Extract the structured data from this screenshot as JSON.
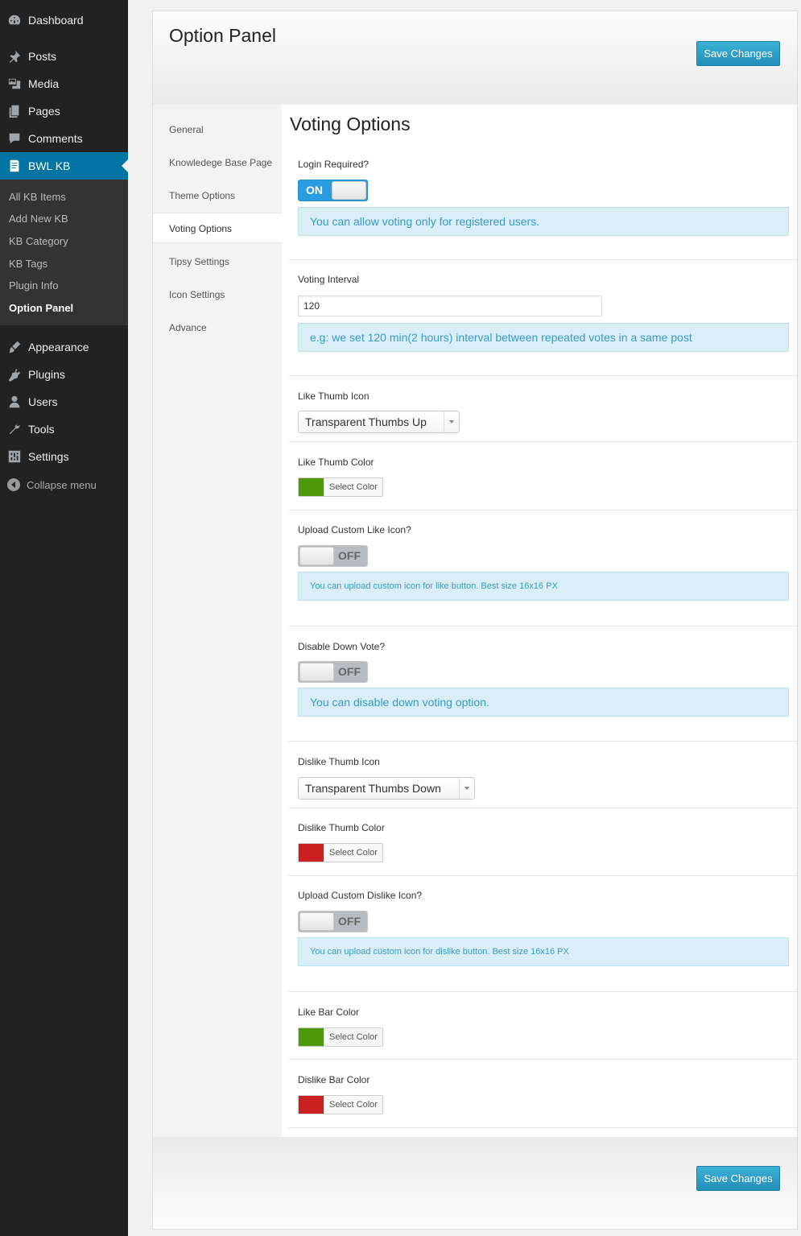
{
  "admin_menu": {
    "items": [
      {
        "label": "Dashboard",
        "icon": "dashboard-icon"
      },
      {
        "label": "Posts",
        "icon": "pin-icon"
      },
      {
        "label": "Media",
        "icon": "media-icon"
      },
      {
        "label": "Pages",
        "icon": "pages-icon"
      },
      {
        "label": "Comments",
        "icon": "comment-icon"
      },
      {
        "label": "BWL KB",
        "icon": "kb-icon"
      }
    ],
    "submenu": [
      "All KB Items",
      "Add New KB",
      "KB Category",
      "KB Tags",
      "Plugin Info",
      "Option Panel"
    ],
    "items2": [
      {
        "label": "Appearance",
        "icon": "brush-icon"
      },
      {
        "label": "Plugins",
        "icon": "plugin-icon"
      },
      {
        "label": "Users",
        "icon": "user-icon"
      },
      {
        "label": "Tools",
        "icon": "wrench-icon"
      },
      {
        "label": "Settings",
        "icon": "settings-icon"
      }
    ],
    "collapse": "Collapse menu"
  },
  "panel": {
    "title": "Option Panel",
    "save_label": "Save Changes",
    "nav": [
      "General",
      "Knowledege Base Page",
      "Theme Options",
      "Voting Options",
      "Tipsy Settings",
      "Icon Settings",
      "Advance"
    ],
    "active_nav": "Voting Options"
  },
  "voting": {
    "title": "Voting Options",
    "login_required": {
      "label": "Login Required?",
      "state": "ON",
      "info": "You can allow voting only for registered users."
    },
    "voting_interval": {
      "label": "Voting Interval",
      "value": "120",
      "info": "e.g: we set 120 min(2 hours) interval between repeated votes in a same post"
    },
    "like_thumb_icon": {
      "label": "Like Thumb Icon",
      "value": "Transparent Thumbs Up"
    },
    "like_thumb_color": {
      "label": "Like Thumb Color",
      "color": "#4e9a06",
      "button": "Select Color"
    },
    "upload_like_icon": {
      "label": "Upload Custom Like Icon?",
      "state": "OFF",
      "info": "You can upload custom icon for like button. Best size 16x16 PX"
    },
    "disable_down_vote": {
      "label": "Disable Down Vote?",
      "state": "OFF",
      "info": "You can disable down voting option."
    },
    "dislike_thumb_icon": {
      "label": "Dislike Thumb Icon",
      "value": "Transparent Thumbs Down"
    },
    "dislike_thumb_color": {
      "label": "Dislike Thumb Color",
      "color": "#cc2020",
      "button": "Select Color"
    },
    "upload_dislike_icon": {
      "label": "Upload Custom Dislike Icon?",
      "state": "OFF",
      "info": "You can upload custom icon for dislike button. Best size 16x16 PX"
    },
    "like_bar_color": {
      "label": "Like Bar Color",
      "color": "#4e9a06",
      "button": "Select Color"
    },
    "dislike_bar_color": {
      "label": "Dislike Bar Color",
      "color": "#cc2020",
      "button": "Select Color"
    }
  }
}
